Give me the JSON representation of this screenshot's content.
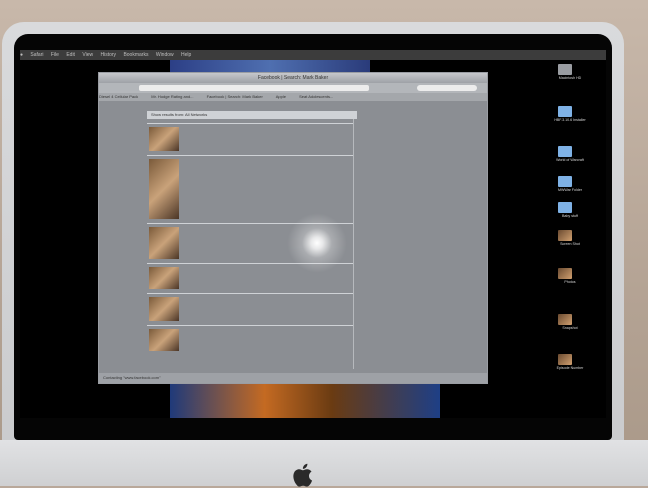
{
  "menubar": {
    "apple": "",
    "items": [
      "Safari",
      "File",
      "Edit",
      "View",
      "History",
      "Bookmarks",
      "Window",
      "Help"
    ]
  },
  "browser": {
    "window_title": "Facebook | Search: Mark Baker",
    "tabs": [
      "Diesel 4 Cellular Pack",
      "Mr. Hodge Rating and...",
      "Facebook | Search: Mark Baker",
      "Apple",
      "Seat Adolescents..."
    ],
    "status_text": "Contacting \"www.facebook.com\"",
    "feed_header": "Show results from: All Networks"
  },
  "colors": {
    "folder": "#7fb2e6",
    "screen": "#050505",
    "bezel": "#d9dadc"
  },
  "desktop_icons": [
    {
      "label": "Macintosh HD",
      "icon": "drive-icon"
    },
    {
      "label": "HBF.3.10.6 Installer",
      "icon": "folder-icon"
    },
    {
      "label": "World of Warcraft",
      "icon": "folder-icon"
    },
    {
      "label": "MWWar Folder",
      "icon": "folder-icon"
    },
    {
      "label": "Baby stuff",
      "icon": "folder-icon"
    },
    {
      "label": "Screen Shot",
      "icon": "image-icon"
    },
    {
      "label": "Photos",
      "icon": "image-icon"
    },
    {
      "label": "Snapshot",
      "icon": "image-icon"
    },
    {
      "label": "Episode Number",
      "icon": "image-icon"
    }
  ]
}
